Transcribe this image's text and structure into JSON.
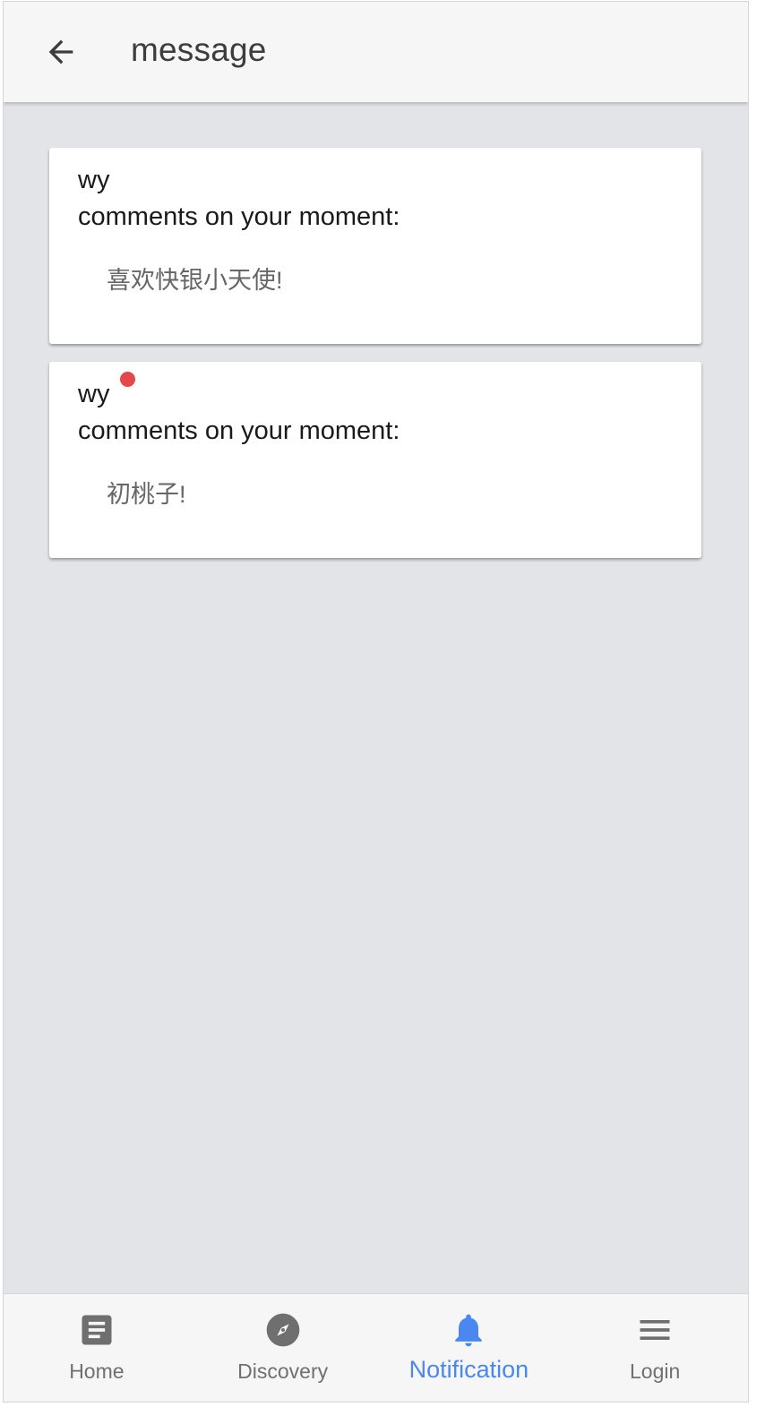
{
  "header": {
    "title": "message",
    "back_icon": "arrow-left-icon"
  },
  "notifications": [
    {
      "user": "wy",
      "action": "comments on your moment:",
      "comment": "喜欢快银小天使!",
      "unread": false
    },
    {
      "user": "wy",
      "action": "comments on your moment:",
      "comment": "初桃子!",
      "unread": true
    }
  ],
  "bottom_nav": {
    "items": [
      {
        "label": "Home",
        "icon": "article-icon",
        "active": false
      },
      {
        "label": "Discovery",
        "icon": "compass-icon",
        "active": false
      },
      {
        "label": "Notification",
        "icon": "bell-icon",
        "active": true
      },
      {
        "label": "Login",
        "icon": "menu-icon",
        "active": false
      }
    ]
  },
  "colors": {
    "accent": "#4a87f0",
    "unread_dot": "#e5484a",
    "background": "#e3e4e7",
    "bar": "#f6f6f6"
  }
}
